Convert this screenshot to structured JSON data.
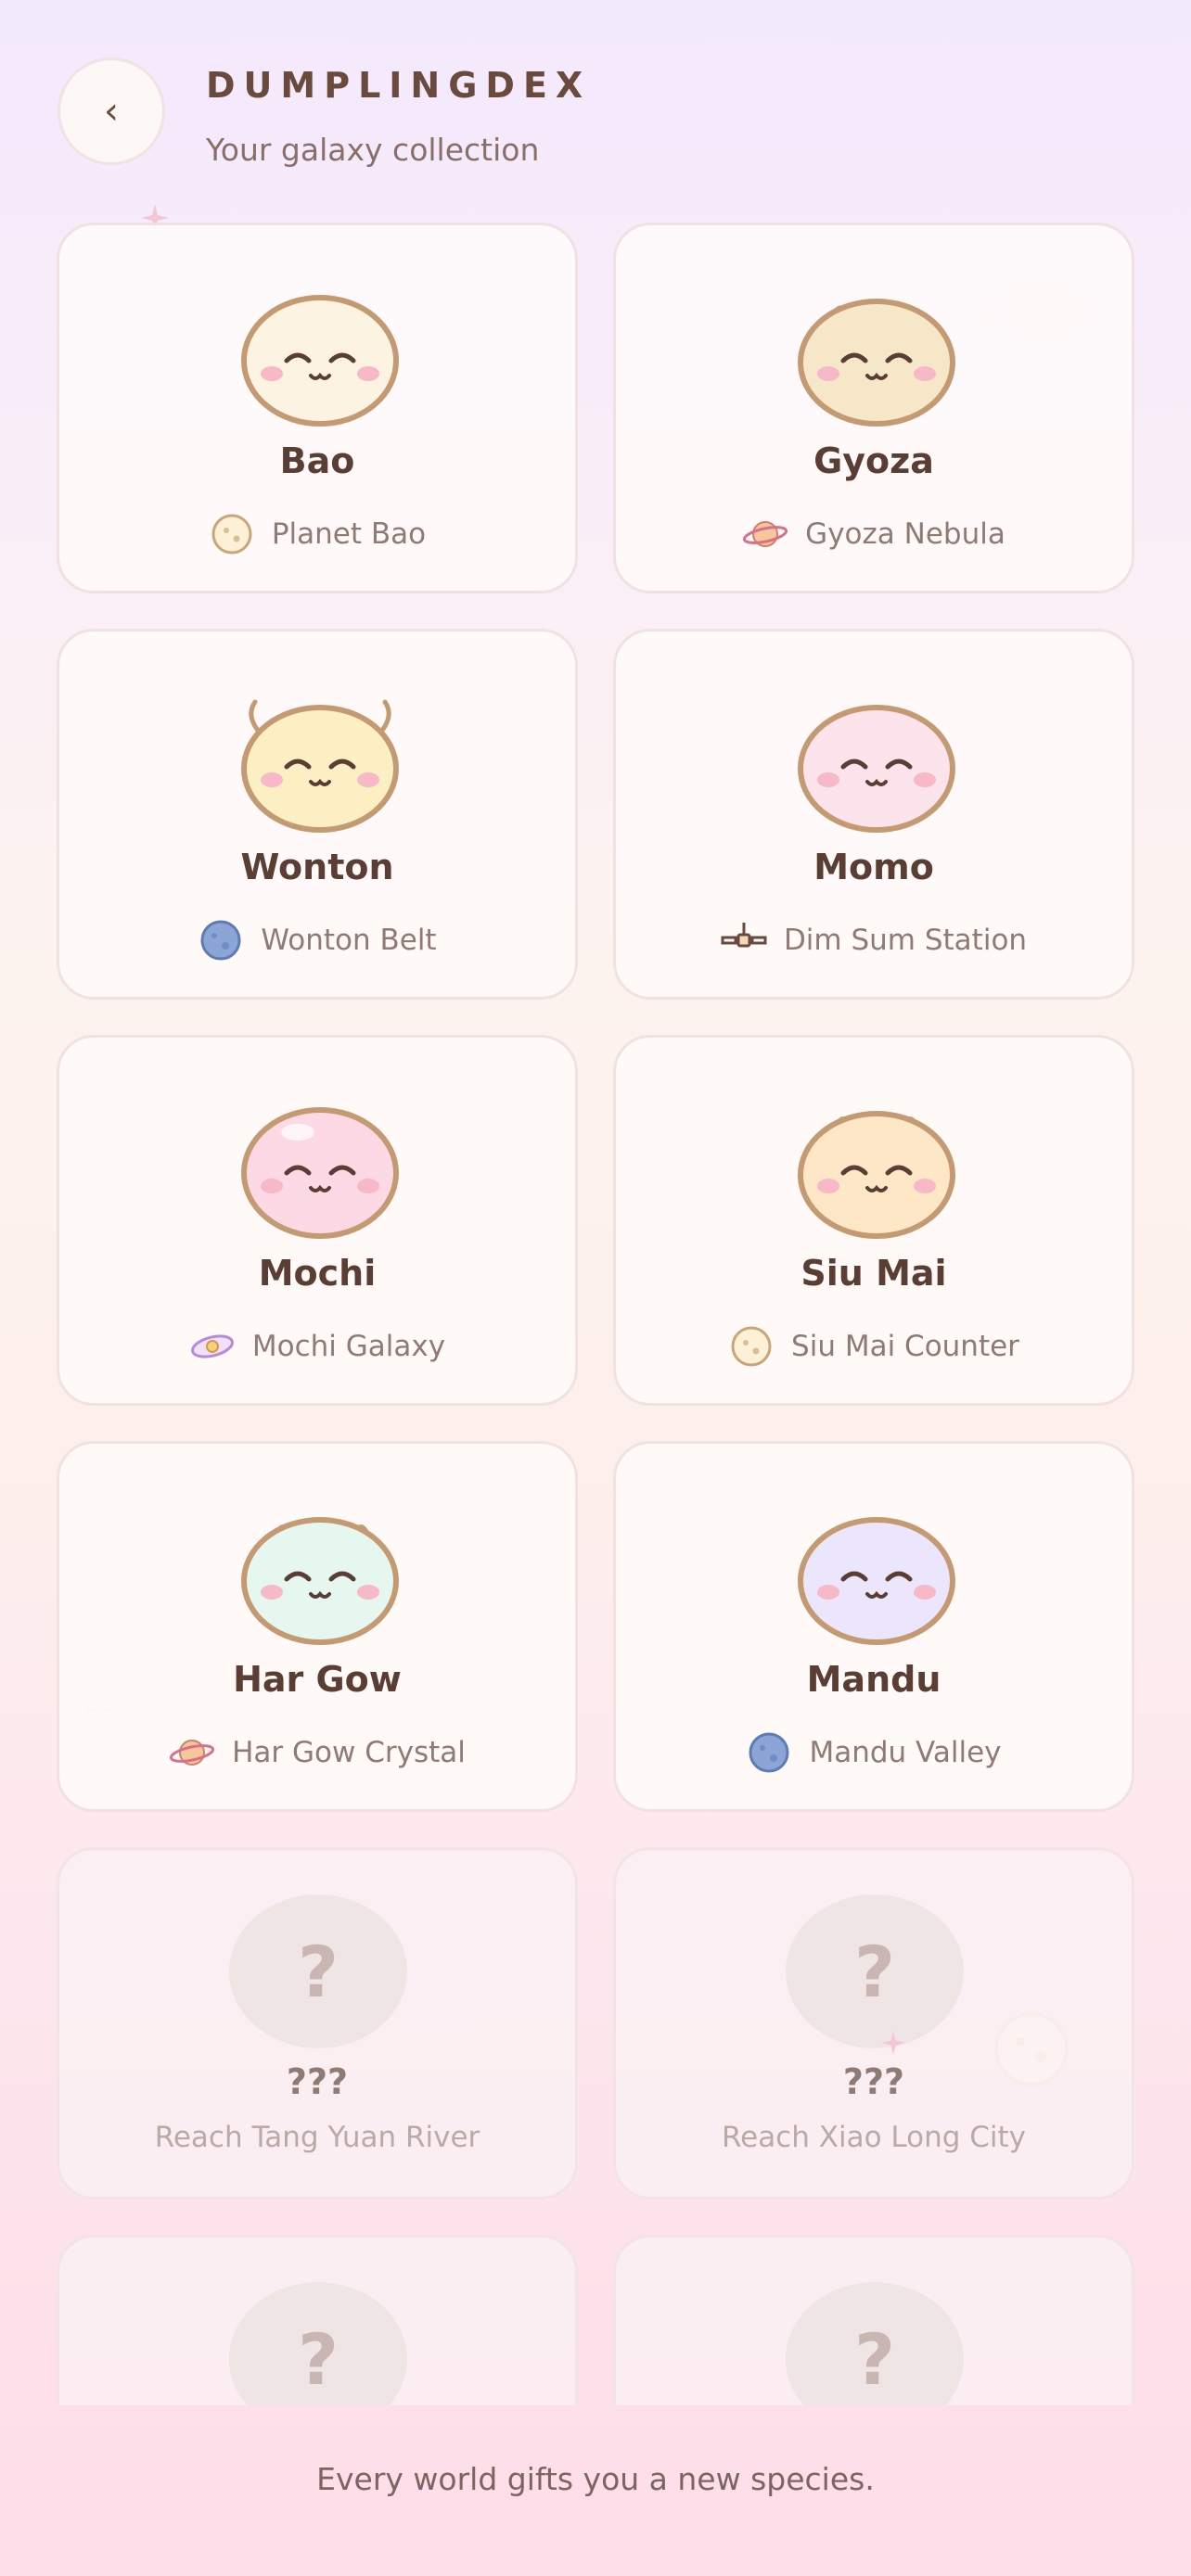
{
  "header": {
    "back_icon": "chevron-left-icon",
    "back_glyph": "‹",
    "title": "DUMPLINGDEX",
    "subtitle": "Your galaxy collection"
  },
  "dumplings": [
    {
      "name": "Bao",
      "origin": "Planet Bao",
      "origin_icon": "moon-icon",
      "body_color": "#fdf3e3"
    },
    {
      "name": "Gyoza",
      "origin": "Gyoza Nebula",
      "origin_icon": "ringed-planet-icon",
      "body_color": "#f7e7c9"
    },
    {
      "name": "Wonton",
      "origin": "Wonton Belt",
      "origin_icon": "blue-planet-icon",
      "body_color": "#fdefc4"
    },
    {
      "name": "Momo",
      "origin": "Dim Sum Station",
      "origin_icon": "satellite-icon",
      "body_color": "#fde3ec"
    },
    {
      "name": "Mochi",
      "origin": "Mochi Galaxy",
      "origin_icon": "galaxy-icon",
      "body_color": "#fdd9e6"
    },
    {
      "name": "Siu Mai",
      "origin": "Siu Mai Counter",
      "origin_icon": "moon-icon",
      "body_color": "#fde7c6"
    },
    {
      "name": "Har Gow",
      "origin": "Har Gow Crystal",
      "origin_icon": "ringed-planet-icon",
      "body_color": "#e6f7ef"
    },
    {
      "name": "Mandu",
      "origin": "Mandu Valley",
      "origin_icon": "blue-planet-icon",
      "body_color": "#ebe6fb"
    }
  ],
  "locked": [
    {
      "name": "???",
      "hint": "Reach Tang Yuan River",
      "glyph": "?"
    },
    {
      "name": "???",
      "hint": "Reach Xiao Long City",
      "glyph": "?"
    },
    {
      "glyph": "?"
    },
    {
      "glyph": "?"
    }
  ],
  "footer": {
    "text": "Every world gifts you a new species."
  },
  "colors": {
    "text_dark": "#5a3d33",
    "text_muted": "#8f7a74",
    "outline": "#c49a72",
    "cheek": "#f7b8c8"
  }
}
